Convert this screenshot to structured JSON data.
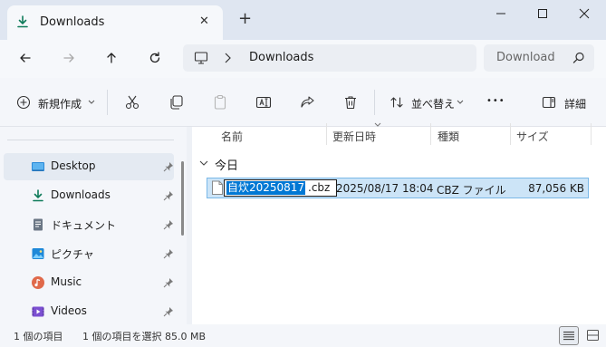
{
  "window": {
    "tab_title": "Downloads",
    "new_tab_symbol": "+",
    "close_tab_symbol": "✕"
  },
  "address": {
    "location": "Downloads",
    "search_placeholder": "Download"
  },
  "toolbar": {
    "new_label": "新規作成",
    "sort_label": "並べ替え",
    "more_label": "•••",
    "details_label": "詳細"
  },
  "sidebar": {
    "items": [
      {
        "label": "Desktop",
        "icon": "desktop-icon"
      },
      {
        "label": "Downloads",
        "icon": "download-icon"
      },
      {
        "label": "ドキュメント",
        "icon": "document-icon"
      },
      {
        "label": "ピクチャ",
        "icon": "pictures-icon"
      },
      {
        "label": "Music",
        "icon": "music-icon"
      },
      {
        "label": "Videos",
        "icon": "videos-icon"
      }
    ]
  },
  "columns": {
    "name": "名前",
    "date": "更新日時",
    "type": "種類",
    "size": "サイズ"
  },
  "group": {
    "label": "今日"
  },
  "file": {
    "rename_selected": "自炊20250817",
    "rename_ext": ".cbz",
    "date": "2025/08/17 18:04",
    "type": "CBZ ファイル",
    "size": "87,056 KB"
  },
  "status": {
    "count": "1 個の項目",
    "selection": "1 個の項目を選択 85.0 MB"
  },
  "colors": {
    "accent": "#0067c0",
    "selection_bg": "#cce4f7",
    "rename_highlight": "#0078d4"
  }
}
